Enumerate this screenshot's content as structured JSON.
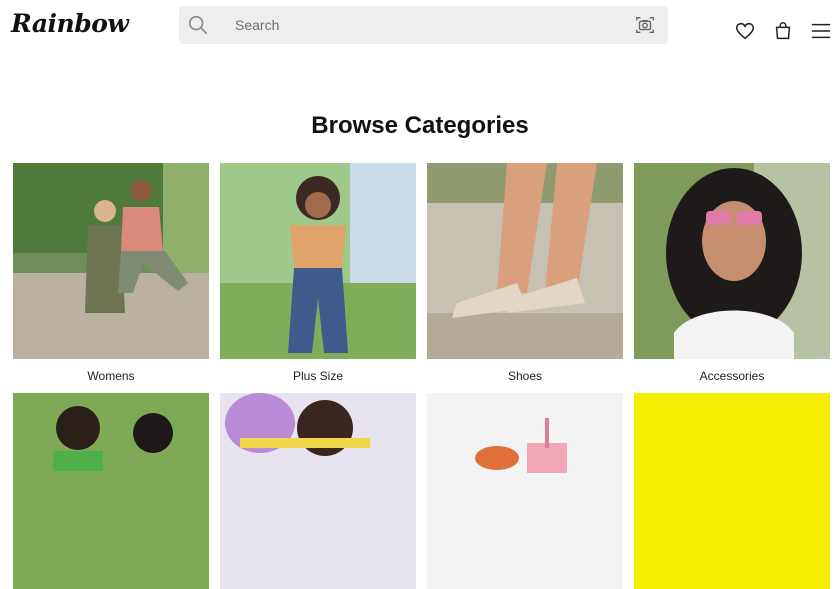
{
  "header": {
    "logo_text": "Rainbow",
    "search": {
      "placeholder": "Search"
    }
  },
  "page_title": "Browse Categories",
  "categories": [
    {
      "label": "Womens"
    },
    {
      "label": "Plus Size"
    },
    {
      "label": "Shoes"
    },
    {
      "label": "Accessories"
    }
  ]
}
